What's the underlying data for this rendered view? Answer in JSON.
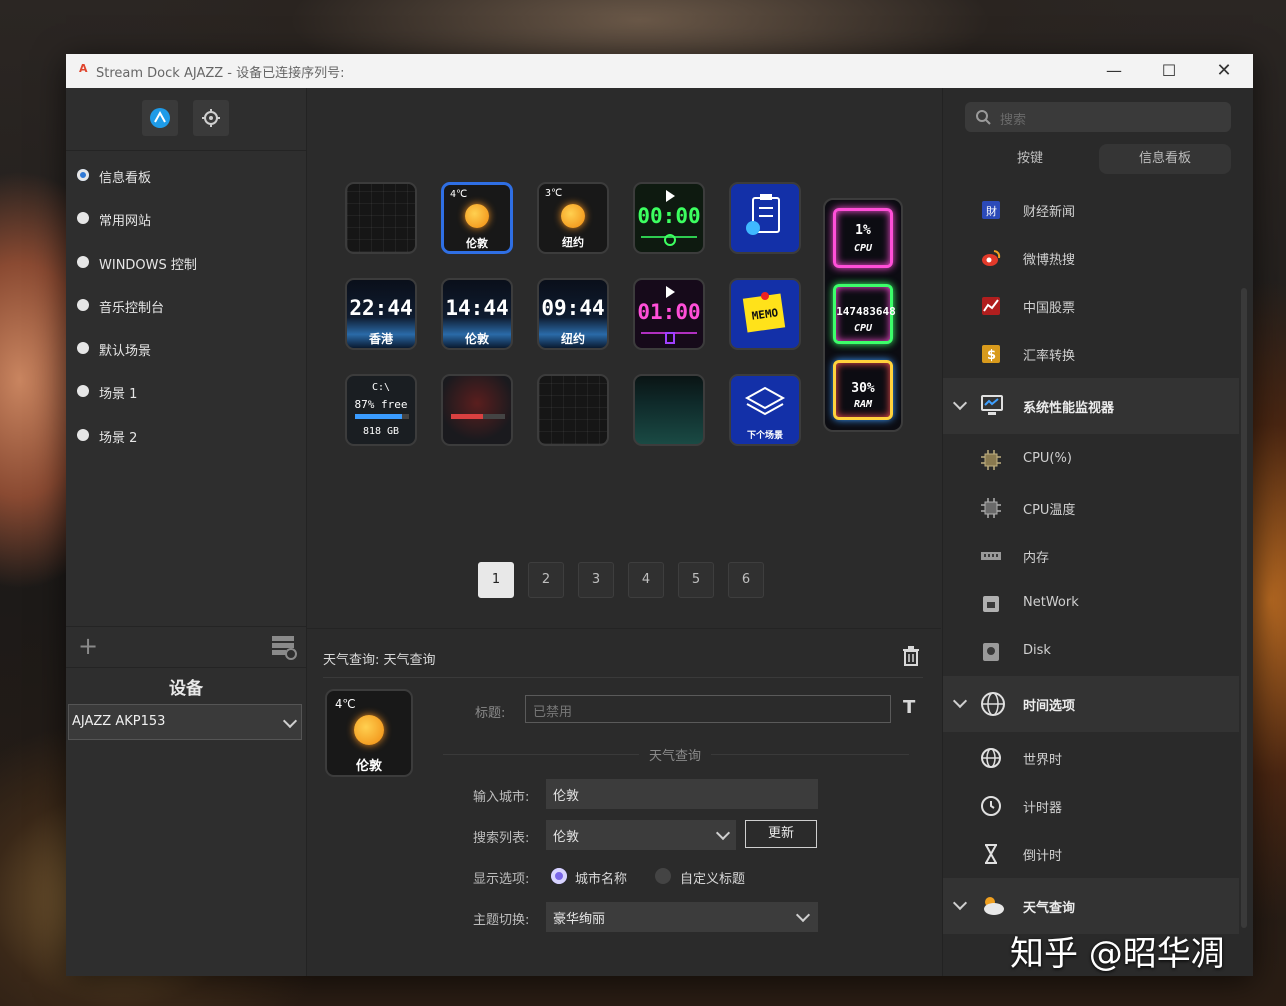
{
  "window": {
    "title": "Stream Dock AJAZZ - 设备已连接序列号:"
  },
  "sidebar": {
    "scenes": [
      {
        "label": "信息看板",
        "selected": true
      },
      {
        "label": "常用网站",
        "selected": false
      },
      {
        "label": "WINDOWS 控制",
        "selected": false
      },
      {
        "label": "音乐控制台",
        "selected": false
      },
      {
        "label": "默认场景",
        "selected": false
      },
      {
        "label": "场景 1",
        "selected": false
      },
      {
        "label": "场景 2",
        "selected": false
      }
    ],
    "add_label": "+",
    "device_title": "设备",
    "device_value": "AJAZZ AKP153"
  },
  "keys": {
    "weather1": {
      "temp": "4℃",
      "city": "伦敦"
    },
    "weather2": {
      "temp": "3℃",
      "city": "纽约"
    },
    "stopwatch": "00:00",
    "clock1": {
      "time": "22:44",
      "city": "香港"
    },
    "clock2": {
      "time": "14:44",
      "city": "伦敦"
    },
    "clock3": {
      "time": "09:44",
      "city": "纽约"
    },
    "timer": "01:00",
    "memo": "MEMO",
    "disk": {
      "drive": "C:\\",
      "free": "87% free",
      "size": "818 GB",
      "free_fraction": 0.87
    },
    "next_scene": "下个场景",
    "gauges": [
      {
        "value": "1%",
        "label": "CPU",
        "color": "#ff4fd8"
      },
      {
        "value": "147483648",
        "label": "CPU",
        "color": "#3cff6a"
      },
      {
        "value": "30%",
        "label": "RAM",
        "color": "#ffd23c"
      }
    ]
  },
  "pages": [
    "1",
    "2",
    "3",
    "4",
    "5",
    "6"
  ],
  "properties": {
    "header": "天气查询: 天气查询",
    "preview": {
      "temp": "4℃",
      "city": "伦敦"
    },
    "title_label": "标题:",
    "title_placeholder": "已禁用",
    "section": "天气查询",
    "city_label": "输入城市:",
    "city_value": "伦敦",
    "search_label": "搜索列表:",
    "search_value": "伦敦",
    "update_button": "更新",
    "display_label": "显示选项:",
    "display_opt1": "城市名称",
    "display_opt2": "自定义标题",
    "theme_label": "主题切换:",
    "theme_value": "豪华绚丽",
    "title_format_icon": "T"
  },
  "plugins": {
    "search_placeholder": "搜索",
    "tabs": [
      "按键",
      "信息看板"
    ],
    "items": [
      {
        "type": "item",
        "label": "财经新闻",
        "icon": "news-icon"
      },
      {
        "type": "item",
        "label": "微博热搜",
        "icon": "weibo-icon"
      },
      {
        "type": "item",
        "label": "中国股票",
        "icon": "stock-icon"
      },
      {
        "type": "item",
        "label": "汇率转换",
        "icon": "exchange-icon"
      },
      {
        "type": "cat",
        "label": "系统性能监视器",
        "icon": "monitor-icon"
      },
      {
        "type": "item",
        "label": "CPU(%)",
        "icon": "cpu-icon"
      },
      {
        "type": "item",
        "label": "CPU温度",
        "icon": "cpu-temp-icon"
      },
      {
        "type": "item",
        "label": "内存",
        "icon": "memory-icon"
      },
      {
        "type": "item",
        "label": "NetWork",
        "icon": "network-icon"
      },
      {
        "type": "item",
        "label": "Disk",
        "icon": "disk-icon"
      },
      {
        "type": "cat",
        "label": "时间选项",
        "icon": "globe-icon"
      },
      {
        "type": "item",
        "label": "世界时",
        "icon": "world-clock-icon"
      },
      {
        "type": "item",
        "label": "计时器",
        "icon": "timer-icon"
      },
      {
        "type": "item",
        "label": "倒计时",
        "icon": "hourglass-icon"
      },
      {
        "type": "cat",
        "label": "天气查询",
        "icon": "weather-icon"
      }
    ]
  },
  "watermark": "知乎 @昭华凋"
}
